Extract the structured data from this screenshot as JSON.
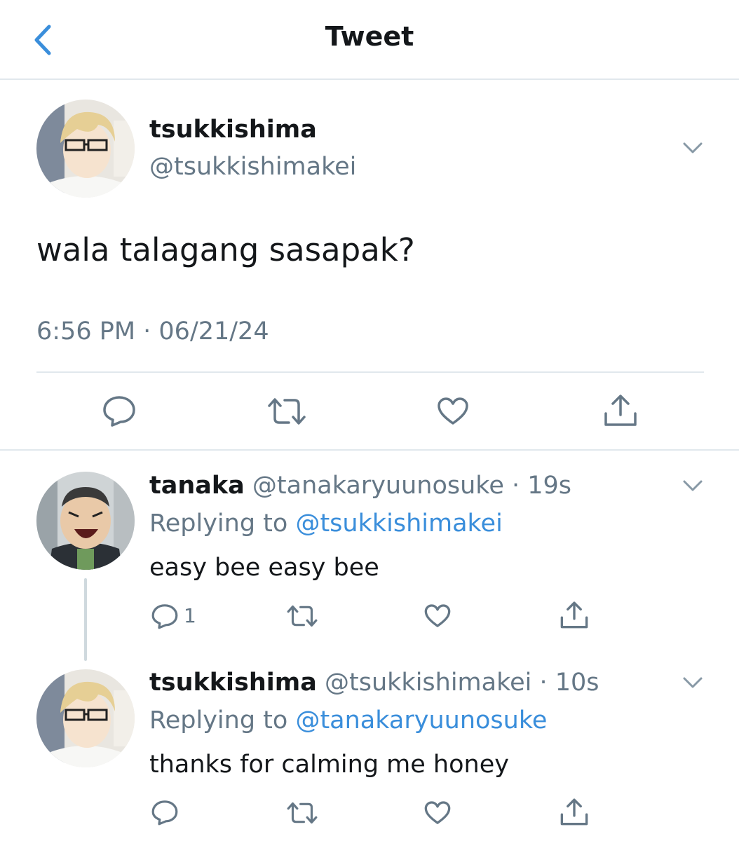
{
  "header": {
    "title": "Tweet",
    "back_icon": "chevron-left-icon"
  },
  "colors": {
    "accent": "#3a8edb",
    "muted": "#657786",
    "text": "#14171a",
    "divider": "#e1e8ed"
  },
  "main_tweet": {
    "name": "tsukkishima",
    "handle": "@tsukkishimakei",
    "text": "wala talagang sasapak?",
    "timestamp": "6:56 PM · 06/21/24",
    "actions": [
      "reply-icon",
      "retweet-icon",
      "like-icon",
      "share-icon"
    ]
  },
  "replies": [
    {
      "name": "tanaka",
      "handle_time": "@tanakaryuunosuke · 19s",
      "replying_prefix": "Replying to ",
      "replying_to": "@tsukkishimakei",
      "text": "easy bee easy bee",
      "reply_count": "1"
    },
    {
      "name": "tsukkishima",
      "handle_time": "@tsukkishimakei · 10s",
      "replying_prefix": "Replying to ",
      "replying_to": "@tanakaryuunosuke",
      "text": "thanks for calming me honey",
      "reply_count": ""
    }
  ]
}
